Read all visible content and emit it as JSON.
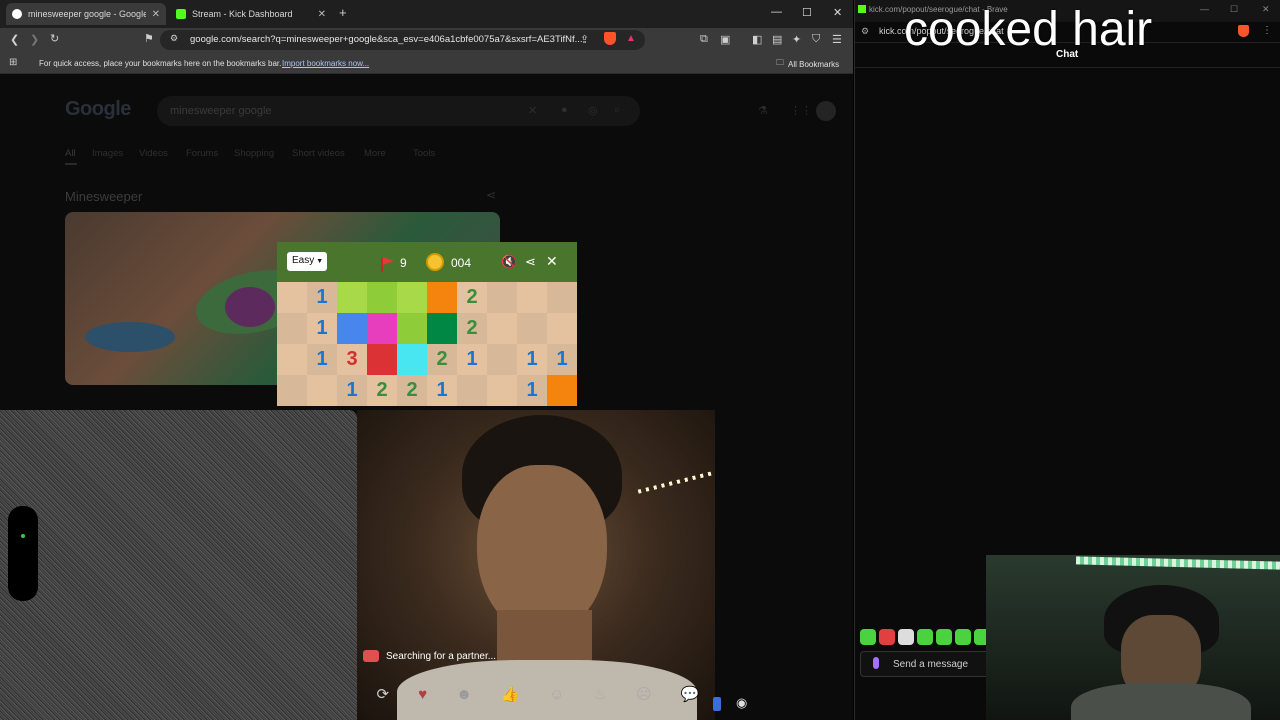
{
  "browser": {
    "tabs": [
      {
        "title": "minesweeper google - Google S",
        "favicon_color": "#ffffff"
      },
      {
        "title": "Stream - Kick Dashboard",
        "favicon_color": "#53fc18"
      }
    ],
    "url": "google.com/search?q=minesweeper+google&sca_esv=e406a1cbfe0075a7&sxsrf=AE3TifNf...",
    "bookmarks_prompt": "For quick access, place your bookmarks here on the bookmarks bar.",
    "bookmarks_link": "Import bookmarks now...",
    "all_bookmarks": "All Bookmarks"
  },
  "google": {
    "logo": "Google",
    "query": "minesweeper google",
    "nav_tabs": [
      "All",
      "Images",
      "Videos",
      "Forums",
      "Shopping",
      "Short videos",
      "More",
      "Tools"
    ],
    "result_title": "Minesweeper"
  },
  "minesweeper": {
    "difficulty": "Easy",
    "flags": "9",
    "timer": "004",
    "grid": [
      [
        {
          "v": "",
          "c": "#e5c29f"
        },
        {
          "v": "1",
          "c": "#d7b899"
        },
        {
          "v": "",
          "c": "#a7d948"
        },
        {
          "v": "",
          "c": "#8ecc39"
        },
        {
          "v": "",
          "c": "#a7d948"
        },
        {
          "v": "",
          "c": "#f4840d"
        },
        {
          "v": "2",
          "c": "#e5c29f"
        },
        {
          "v": "",
          "c": "#d7b899"
        },
        {
          "v": "",
          "c": "#e5c29f"
        },
        {
          "v": "",
          "c": "#d7b899"
        }
      ],
      [
        {
          "v": "",
          "c": "#d7b899"
        },
        {
          "v": "1",
          "c": "#e5c29f"
        },
        {
          "v": "",
          "c": "#4885ed"
        },
        {
          "v": "",
          "c": "#e63ebd"
        },
        {
          "v": "",
          "c": "#8ecc39"
        },
        {
          "v": "",
          "c": "#008744"
        },
        {
          "v": "2",
          "c": "#d7b899"
        },
        {
          "v": "",
          "c": "#e5c29f"
        },
        {
          "v": "",
          "c": "#d7b899"
        },
        {
          "v": "",
          "c": "#e5c29f"
        }
      ],
      [
        {
          "v": "",
          "c": "#e5c29f"
        },
        {
          "v": "1",
          "c": "#d7b899"
        },
        {
          "v": "3",
          "c": "#e5c29f"
        },
        {
          "v": "",
          "c": "#db3236"
        },
        {
          "v": "",
          "c": "#48e6f1"
        },
        {
          "v": "2",
          "c": "#d7b899"
        },
        {
          "v": "1",
          "c": "#e5c29f"
        },
        {
          "v": "",
          "c": "#d7b899"
        },
        {
          "v": "1",
          "c": "#e5c29f"
        },
        {
          "v": "1",
          "c": "#d7b899"
        }
      ],
      [
        {
          "v": "",
          "c": "#d7b899"
        },
        {
          "v": "",
          "c": "#e5c29f"
        },
        {
          "v": "1",
          "c": "#d7b899"
        },
        {
          "v": "2",
          "c": "#e5c29f"
        },
        {
          "v": "2",
          "c": "#d7b899"
        },
        {
          "v": "1",
          "c": "#e5c29f"
        },
        {
          "v": "",
          "c": "#d7b899"
        },
        {
          "v": "",
          "c": "#e5c29f"
        },
        {
          "v": "1",
          "c": "#d7b899"
        },
        {
          "v": "",
          "c": "#f4840d"
        }
      ]
    ]
  },
  "videochat": {
    "status": "Searching for a partner...",
    "reactions": [
      "refresh-icon",
      "heart-icon",
      "laugh-icon",
      "thumbs-up-icon",
      "smile-icon",
      "fire-icon",
      "heart-eyes-icon",
      "chat-icon"
    ]
  },
  "kick": {
    "window_title": "kick.com/popout/seerogue/chat - Brave",
    "url": "kick.com/popout/seerogue/chat",
    "heading": "Chat",
    "send_placeholder": "Send a message",
    "overlay_text": "cooked hair",
    "accent": "#53fc18"
  }
}
